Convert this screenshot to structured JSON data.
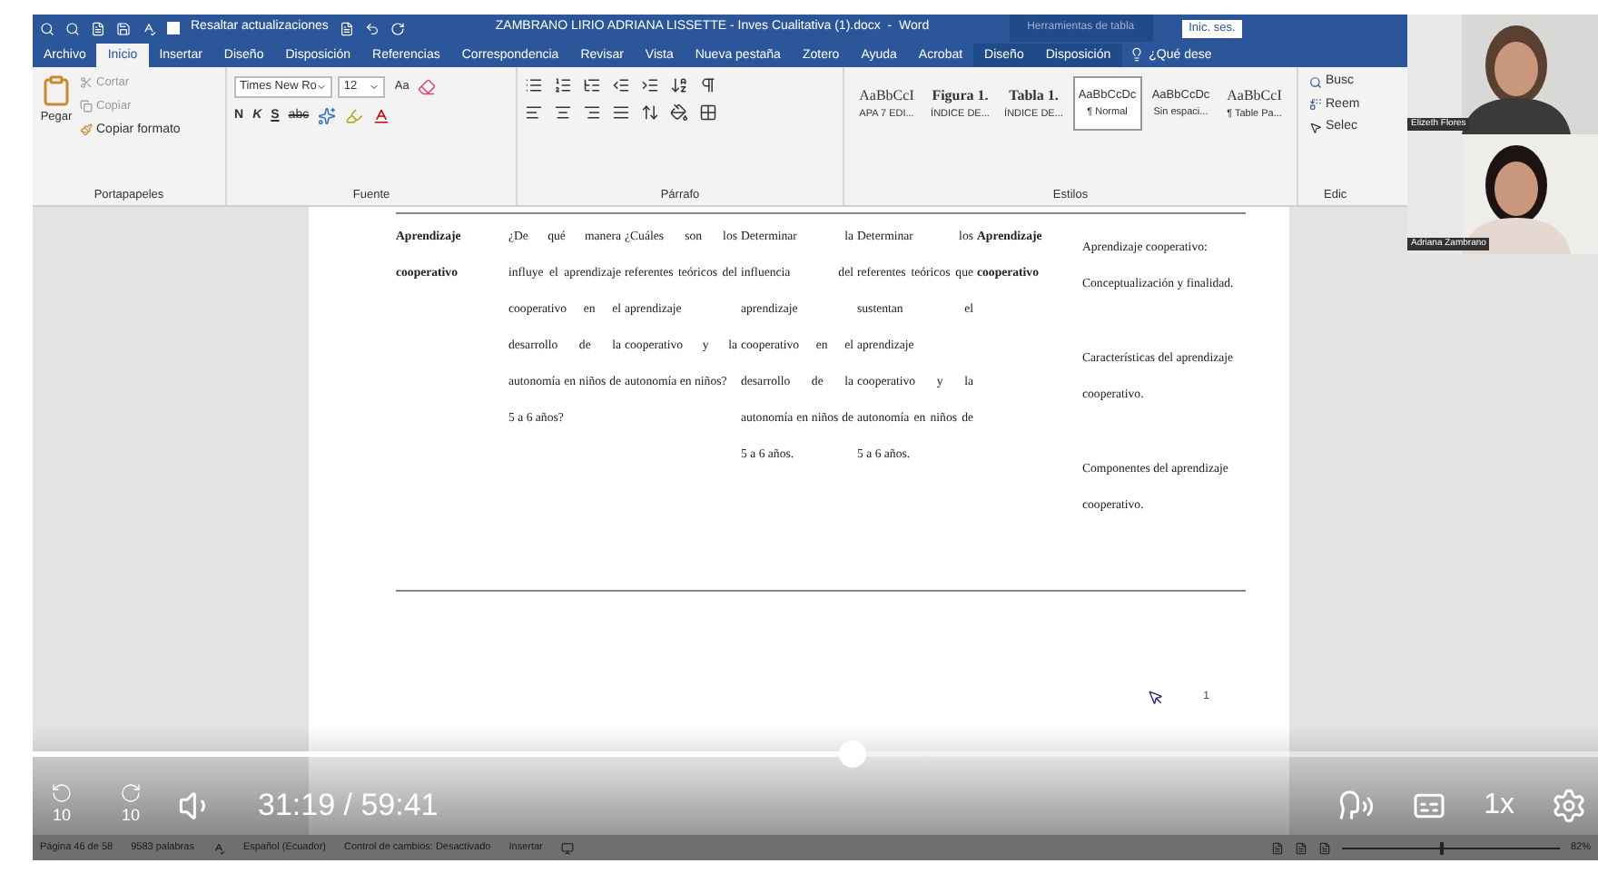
{
  "window": {
    "title": "ZAMBRANO LIRIO ADRIANA LISSETTE - Inves Cualitativa (1).docx  -  Word",
    "quick_access": {
      "label": "Resaltar actualizaciones",
      "checked": false
    },
    "context_tools": "Herramientas de tabla",
    "sign_in": "Inic. ses."
  },
  "tabs": [
    {
      "label": "Archivo",
      "selected": false
    },
    {
      "label": "Inicio",
      "selected": true
    },
    {
      "label": "Insertar",
      "selected": false
    },
    {
      "label": "Diseño",
      "selected": false
    },
    {
      "label": "Disposición",
      "selected": false
    },
    {
      "label": "Referencias",
      "selected": false
    },
    {
      "label": "Correspondencia",
      "selected": false
    },
    {
      "label": "Revisar",
      "selected": false
    },
    {
      "label": "Vista",
      "selected": false
    },
    {
      "label": "Nueva pestaña",
      "selected": false
    },
    {
      "label": "Zotero",
      "selected": false
    },
    {
      "label": "Ayuda",
      "selected": false
    },
    {
      "label": "Acrobat",
      "selected": false
    },
    {
      "label": "Diseño",
      "selected": false
    },
    {
      "label": "Disposición",
      "selected": false
    }
  ],
  "tell_me": "¿Qué dese",
  "clipboard": {
    "paste": "Pegar",
    "cut": "Cortar",
    "copy": "Copiar",
    "format_painter": "Copiar formato",
    "group": "Portapapeles"
  },
  "font": {
    "name": "Times New Ro",
    "size": "12",
    "case": "Aa",
    "bold": "N",
    "italic": "K",
    "underline": "S",
    "strike": "abc",
    "group": "Fuente"
  },
  "paragraph": {
    "group": "Párrafo"
  },
  "styles": {
    "group": "Estilos",
    "items": [
      {
        "preview": "AaBbCcI",
        "label": "APA 7 EDI...",
        "kind": "serif",
        "selected": false
      },
      {
        "preview": "Figura 1.",
        "label": "ÍNDICE DE...",
        "kind": "bold",
        "selected": false
      },
      {
        "preview": "Tabla 1.",
        "label": "ÍNDICE DE...",
        "kind": "bold",
        "selected": false
      },
      {
        "preview": "AaBbCcDc",
        "label": "¶ Normal",
        "kind": "sans",
        "selected": true
      },
      {
        "preview": "AaBbCcDc",
        "label": "Sin espaci...",
        "kind": "sans",
        "selected": false
      },
      {
        "preview": "AaBbCcI",
        "label": "¶ Table Pa...",
        "kind": "serif",
        "selected": false
      }
    ]
  },
  "editing": {
    "find": "Busc",
    "replace": "Reem",
    "select": "Selec",
    "group": "Edic"
  },
  "table": {
    "rows": [
      {
        "cells": [
          {
            "text": "Aprendizaje cooperativo",
            "bold": true
          },
          {
            "text": "¿De qué manera influye el aprendizaje cooperativo en el desarrollo de la autonomía en niños de 5 a 6 años?",
            "bold": false
          },
          {
            "text": "¿Cuáles son los referentes teóricos del aprendizaje cooperativo y la autonomía en niños?",
            "bold": false
          },
          {
            "text": "Determinar la influencia del aprendizaje cooperativo en el desarrollo de la autonomía en niños de 5 a 6 años.",
            "bold": false
          },
          {
            "text": "Determinar los referentes teóricos que sustentan el aprendizaje cooperativo y la autonomía en niños de 5 a 6 años.",
            "bold": false
          },
          {
            "text": "Aprendizaje cooperativo",
            "bold": true
          }
        ],
        "topics": [
          "Aprendizaje cooperativo: Conceptualización y finalidad.",
          "Características del aprendizaje cooperativo.",
          "Componentes del aprendizaje cooperativo."
        ]
      }
    ]
  },
  "page_number": "1",
  "participants": [
    {
      "name": "Elizeth Flores"
    },
    {
      "name": "Adriana Zambrano"
    }
  ],
  "player": {
    "level": 0.523,
    "skip_back": "10",
    "skip_forward": "10",
    "time": "31:19 / 59:41",
    "speed": "1x"
  },
  "status_bar": {
    "page": "Página 46 de 58",
    "words": "9583 palabras",
    "language": "Español (Ecuador)",
    "track_changes": "Control de cambios: Desactivado",
    "mode": "Insertar",
    "zoom": "82%",
    "zoom_slider": {
      "level": 0.45
    }
  }
}
